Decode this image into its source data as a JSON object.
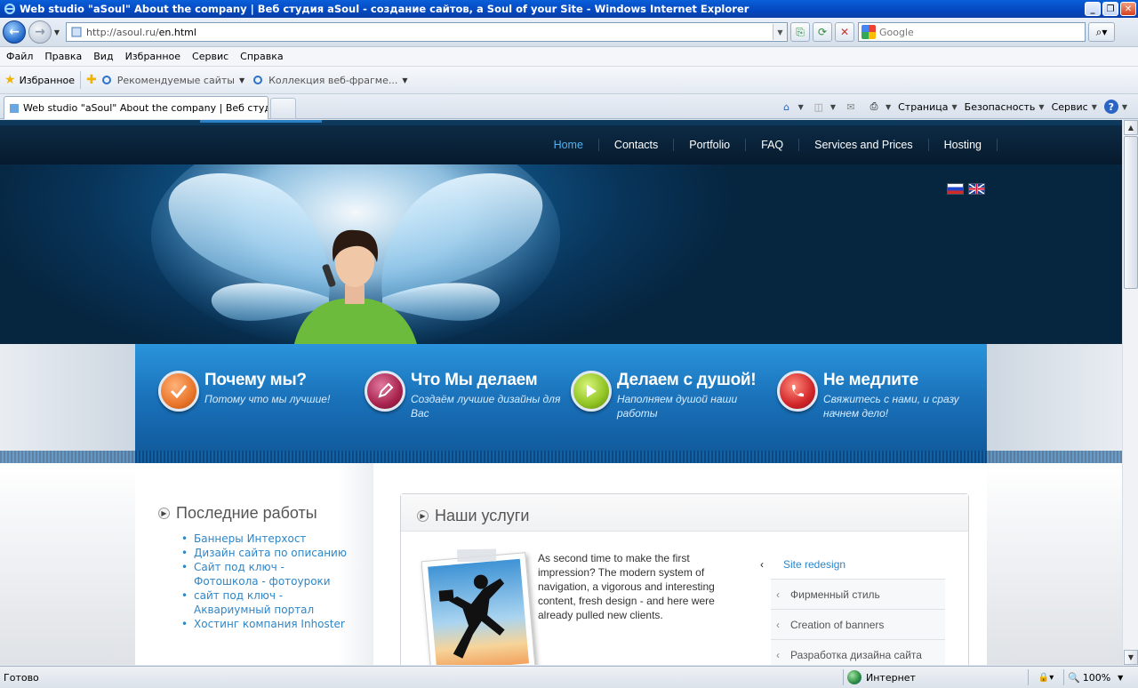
{
  "window": {
    "title": "Web studio \"aSoul\" About the company | Веб студия aSoul - создание сайтов, a Soul of your Site - Windows Internet Explorer",
    "min": "_",
    "max": "❐",
    "close": "✕"
  },
  "address": {
    "url_host": "http://asoul.ru/",
    "url_path": "en.html",
    "search_placeholder": "Google"
  },
  "menu": [
    "Файл",
    "Правка",
    "Вид",
    "Избранное",
    "Сервис",
    "Справка"
  ],
  "favorites": {
    "label": "Избранное",
    "items": [
      "Рекомендуемые сайты",
      "Коллекция веб-фрагме..."
    ]
  },
  "tabs": [
    {
      "label": "Web studio \"aSoul\" About the company | Веб студия ..."
    }
  ],
  "commandbar": {
    "page": "Страница",
    "security": "Безопасность",
    "tools": "Сервис"
  },
  "site": {
    "nav": [
      "Home",
      "Contacts",
      "Portfolio",
      "FAQ",
      "Services and Prices",
      "Hosting"
    ],
    "nav_active": "Home",
    "features": [
      {
        "title": "Почему мы?",
        "subtitle": "Потому что мы лучшие!",
        "color": "#e9752a",
        "icon": "check-icon"
      },
      {
        "title": "Что Мы делаем",
        "subtitle": "Создаём лучшие дизайны для Вас",
        "color": "#a8234d",
        "icon": "pencil-icon"
      },
      {
        "title": "Делаем с душой!",
        "subtitle": "Наполняем душой наши работы",
        "color": "#8fc321",
        "icon": "play-icon"
      },
      {
        "title": "Не медлите",
        "subtitle": "Свяжитесь с нами, и сразу начнем дело!",
        "color": "#d1262a",
        "icon": "phone-icon"
      }
    ],
    "recent": {
      "heading": "Последние работы",
      "items": [
        "Баннеры Интерхост",
        "Дизайн сайта по описанию",
        "Сайт под ключ - Фотошкола - фотоуроки",
        "сайт под ключ - Аквариумный портал",
        "Хостинг компания Inhoster"
      ]
    },
    "services": {
      "heading": "Наши услуги",
      "text": "As second time to make the first impression? The modern system of navigation, a vigorous and interesting content, fresh design - and here were already pulled new clients.",
      "menu": [
        "Site redesign",
        "Фирменный стиль",
        "Creation of banners",
        "Разработка дизайна сайта"
      ],
      "active": "Site redesign"
    }
  },
  "status": {
    "text": "Готово",
    "zone": "Интернет",
    "zoom": "100%"
  }
}
